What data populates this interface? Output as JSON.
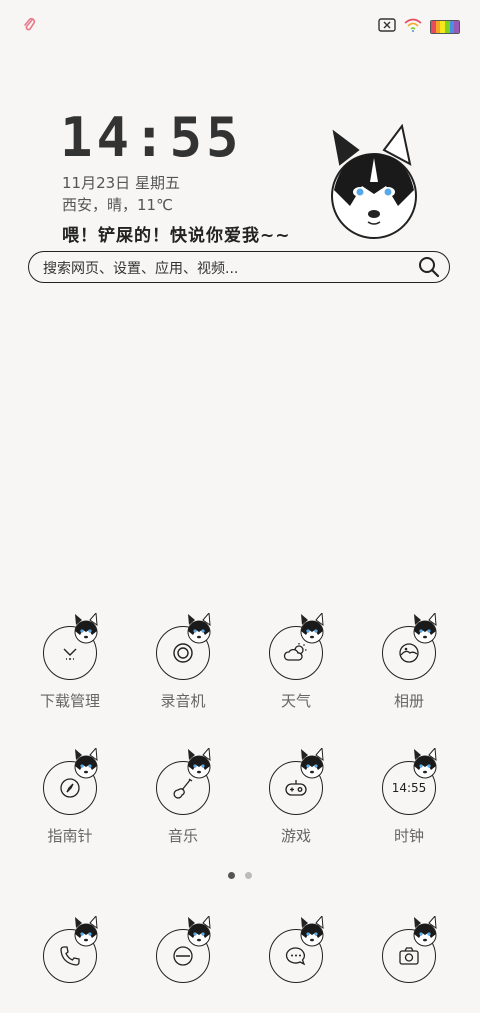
{
  "status_bar": {
    "left_icon": "paperclip-icon",
    "right_icons": [
      "no-sim-icon",
      "wifi-icon",
      "battery-icon"
    ],
    "battery_colors": [
      "#e84a5f",
      "#f5a623",
      "#f8e71c",
      "#7ed321",
      "#4a90e2",
      "#9b59b6"
    ]
  },
  "widget": {
    "time": "14:55",
    "date": "11月23日 星期五",
    "weather": "西安，晴，11℃",
    "slogan": "喂！铲屎的！快说你爱我~~"
  },
  "search": {
    "placeholder": "搜索网页、设置、应用、视频..."
  },
  "apps": [
    {
      "label": "下载管理",
      "icon": "download-icon"
    },
    {
      "label": "录音机",
      "icon": "record-icon"
    },
    {
      "label": "天气",
      "icon": "weather-icon"
    },
    {
      "label": "相册",
      "icon": "gallery-icon"
    },
    {
      "label": "指南针",
      "icon": "compass-icon"
    },
    {
      "label": "音乐",
      "icon": "guitar-icon"
    },
    {
      "label": "游戏",
      "icon": "gamepad-icon"
    },
    {
      "label": "时钟",
      "icon": "clock-icon",
      "text": "14:55"
    }
  ],
  "dock": [
    {
      "icon": "phone-icon"
    },
    {
      "icon": "browser-icon"
    },
    {
      "icon": "message-icon"
    },
    {
      "icon": "camera-icon"
    }
  ],
  "pages": {
    "count": 2,
    "active": 1
  }
}
